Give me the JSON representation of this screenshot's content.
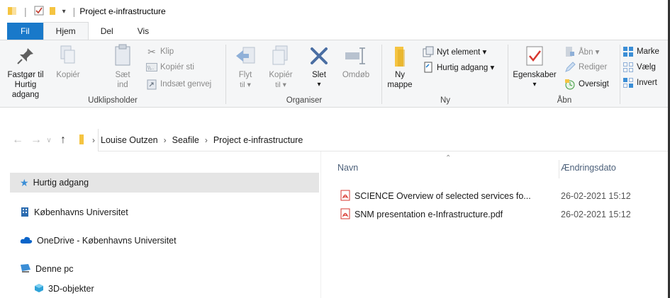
{
  "window": {
    "title": "Project e-infrastructure"
  },
  "tabs": [
    {
      "label": "Fil"
    },
    {
      "label": "Hjem"
    },
    {
      "label": "Del"
    },
    {
      "label": "Vis"
    }
  ],
  "ribbon": {
    "clipboard": {
      "pin_label_1": "Fastgør til",
      "pin_label_2": "Hurtig adgang",
      "copy_label": "Kopiér",
      "paste_label_1": "Sæt",
      "paste_label_2": "ind",
      "cut_label": "Klip",
      "copy_path_label": "Kopiér sti",
      "paste_shortcut_label": "Indsæt genvej",
      "group_label": "Udklipsholder"
    },
    "organize": {
      "move_label_1": "Flyt",
      "move_label_2": "til ▾",
      "copyto_label_1": "Kopiér",
      "copyto_label_2": "til ▾",
      "delete_label": "Slet",
      "delete_caret": "▾",
      "rename_label": "Omdøb",
      "group_label": "Organiser"
    },
    "new": {
      "folder_label_1": "Ny",
      "folder_label_2": "mappe",
      "new_item_label": "Nyt element ▾",
      "easy_access_label": "Hurtig adgang ▾",
      "group_label": "Ny"
    },
    "open": {
      "properties_label": "Egenskaber",
      "properties_caret": "▾",
      "open_label": "Åbn ▾",
      "edit_label": "Rediger",
      "history_label": "Oversigt",
      "group_label": "Åbn"
    },
    "select": {
      "select_all_label": "Marke",
      "select_none_label": "Vælg",
      "invert_label": "Invert"
    }
  },
  "address": {
    "crumbs": [
      "Louise Outzen",
      "Seafile",
      "Project e-infrastructure"
    ]
  },
  "navpane": {
    "items": [
      {
        "label": "Hurtig adgang"
      },
      {
        "label": "Københavns Universitet"
      },
      {
        "label": "OneDrive - Københavns Universitet"
      },
      {
        "label": "Denne pc"
      },
      {
        "label": "3D-objekter"
      }
    ]
  },
  "filelist": {
    "columns": {
      "name": "Navn",
      "date": "Ændringsdato"
    },
    "rows": [
      {
        "name": "SCIENCE Overview of selected services fo...",
        "date": "26-02-2021 15:12"
      },
      {
        "name": "SNM presentation e-Infrastructure.pdf",
        "date": "26-02-2021 15:12"
      }
    ]
  },
  "colors": {
    "file_tab": "#1979ca",
    "ribbon_bg": "#f5f6f7",
    "folder_yellow": "#f5c441",
    "pdf_red": "#d7372f",
    "selection_gray": "#e5e5e5"
  }
}
